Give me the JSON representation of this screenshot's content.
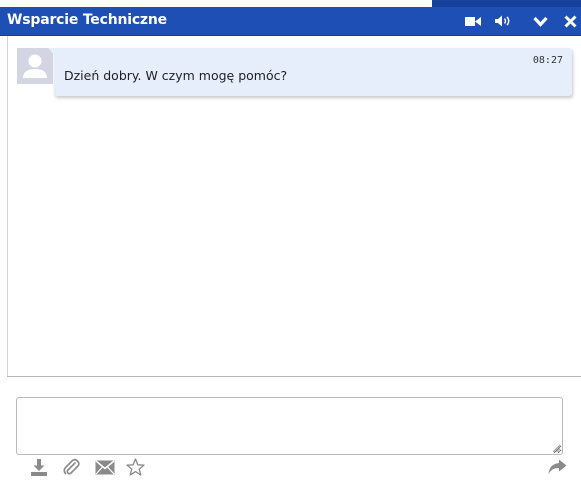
{
  "header": {
    "title": "Wsparcie Techniczne",
    "background_color": "#1e4fb4",
    "buttons": [
      {
        "name": "video-icon",
        "action": "start video call"
      },
      {
        "name": "speaker-icon",
        "action": "toggle sound"
      },
      {
        "name": "chevron-down-icon",
        "action": "minimize"
      },
      {
        "name": "close-icon",
        "action": "close"
      }
    ]
  },
  "messages": [
    {
      "sender": "agent",
      "avatar_icon": "user-silhouette-icon",
      "time": "08:27",
      "text": "Dzień dobry. W czym mogę pomóc?",
      "bubble_color": "#e6edfb"
    }
  ],
  "composer": {
    "value": "",
    "placeholder": ""
  },
  "toolbar": {
    "left_icons": [
      "download-icon",
      "paperclip-icon",
      "email-icon",
      "star-icon"
    ],
    "right_icons": [
      "forward-arrow-icon"
    ],
    "icon_color": "#8a8a8a"
  }
}
